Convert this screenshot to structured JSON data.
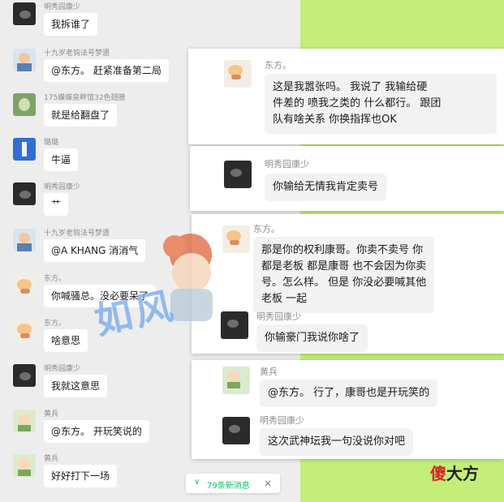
{
  "left_chat": [
    {
      "name": "明秀园康少",
      "text": "我拆谁了",
      "avatar": "dark"
    },
    {
      "name": "十九岁老钩法号梦遗",
      "text": "@东方。 赶紧准备第二局",
      "avatar": "kid"
    },
    {
      "name": "175蝶蝶泉畔馆32色翅膀",
      "text": "就是给翻盘了",
      "avatar": "green"
    },
    {
      "name": "璐璐",
      "text": "牛逼",
      "avatar": "blue"
    },
    {
      "name": "明秀园康少",
      "text": "艹",
      "avatar": "dark"
    },
    {
      "name": "十九岁老钩法号梦遗",
      "text": "@A KHANG 消消气",
      "avatar": "kid"
    },
    {
      "name": "东方。",
      "text": "你喊骚总。没必要呆了",
      "avatar": "cat"
    },
    {
      "name": "东方。",
      "text": "啥意思",
      "avatar": "cat"
    },
    {
      "name": "明秀园康少",
      "text": "我就这意思",
      "avatar": "dark"
    },
    {
      "name": "黄兵",
      "text": "@东方。 开玩笑说的",
      "avatar": "cute"
    },
    {
      "name": "黄兵",
      "text": "好好打下一场",
      "avatar": "cute"
    }
  ],
  "cards": {
    "c1": {
      "name": "东方。",
      "text": [
        "这是我嚣张吗。   我说了 我输给硬",
        "件差的 喷我之类的 什么都行。 跟团",
        "队有啥关系 你换指挥也OK"
      ]
    },
    "c2": {
      "name": "明秀园康少",
      "text": "你输给无情我肯定卖号"
    },
    "c3": {
      "name": "东方。",
      "text": [
        "那是你的权利康哥。你卖不卖号 你",
        "都是老板 都是康哥  也不会因为你卖",
        "号。怎么样。 但是 你没必要喊其他",
        "老板 一起"
      ],
      "name2": "明秀园康少",
      "text2": "你输豪门我说你啥了"
    },
    "c4": {
      "name": "黄兵",
      "text": "@东方。 行了，康哥也是开玩笑的",
      "name2": "明秀园康少",
      "text2": "这次武神坛我一句没说你对吧"
    }
  },
  "new_messages": {
    "label": "79条新消息",
    "chevron": "∨",
    "close": "×"
  },
  "brand": {
    "part1": "傻",
    "part2": "大方"
  },
  "watermark": "如风"
}
